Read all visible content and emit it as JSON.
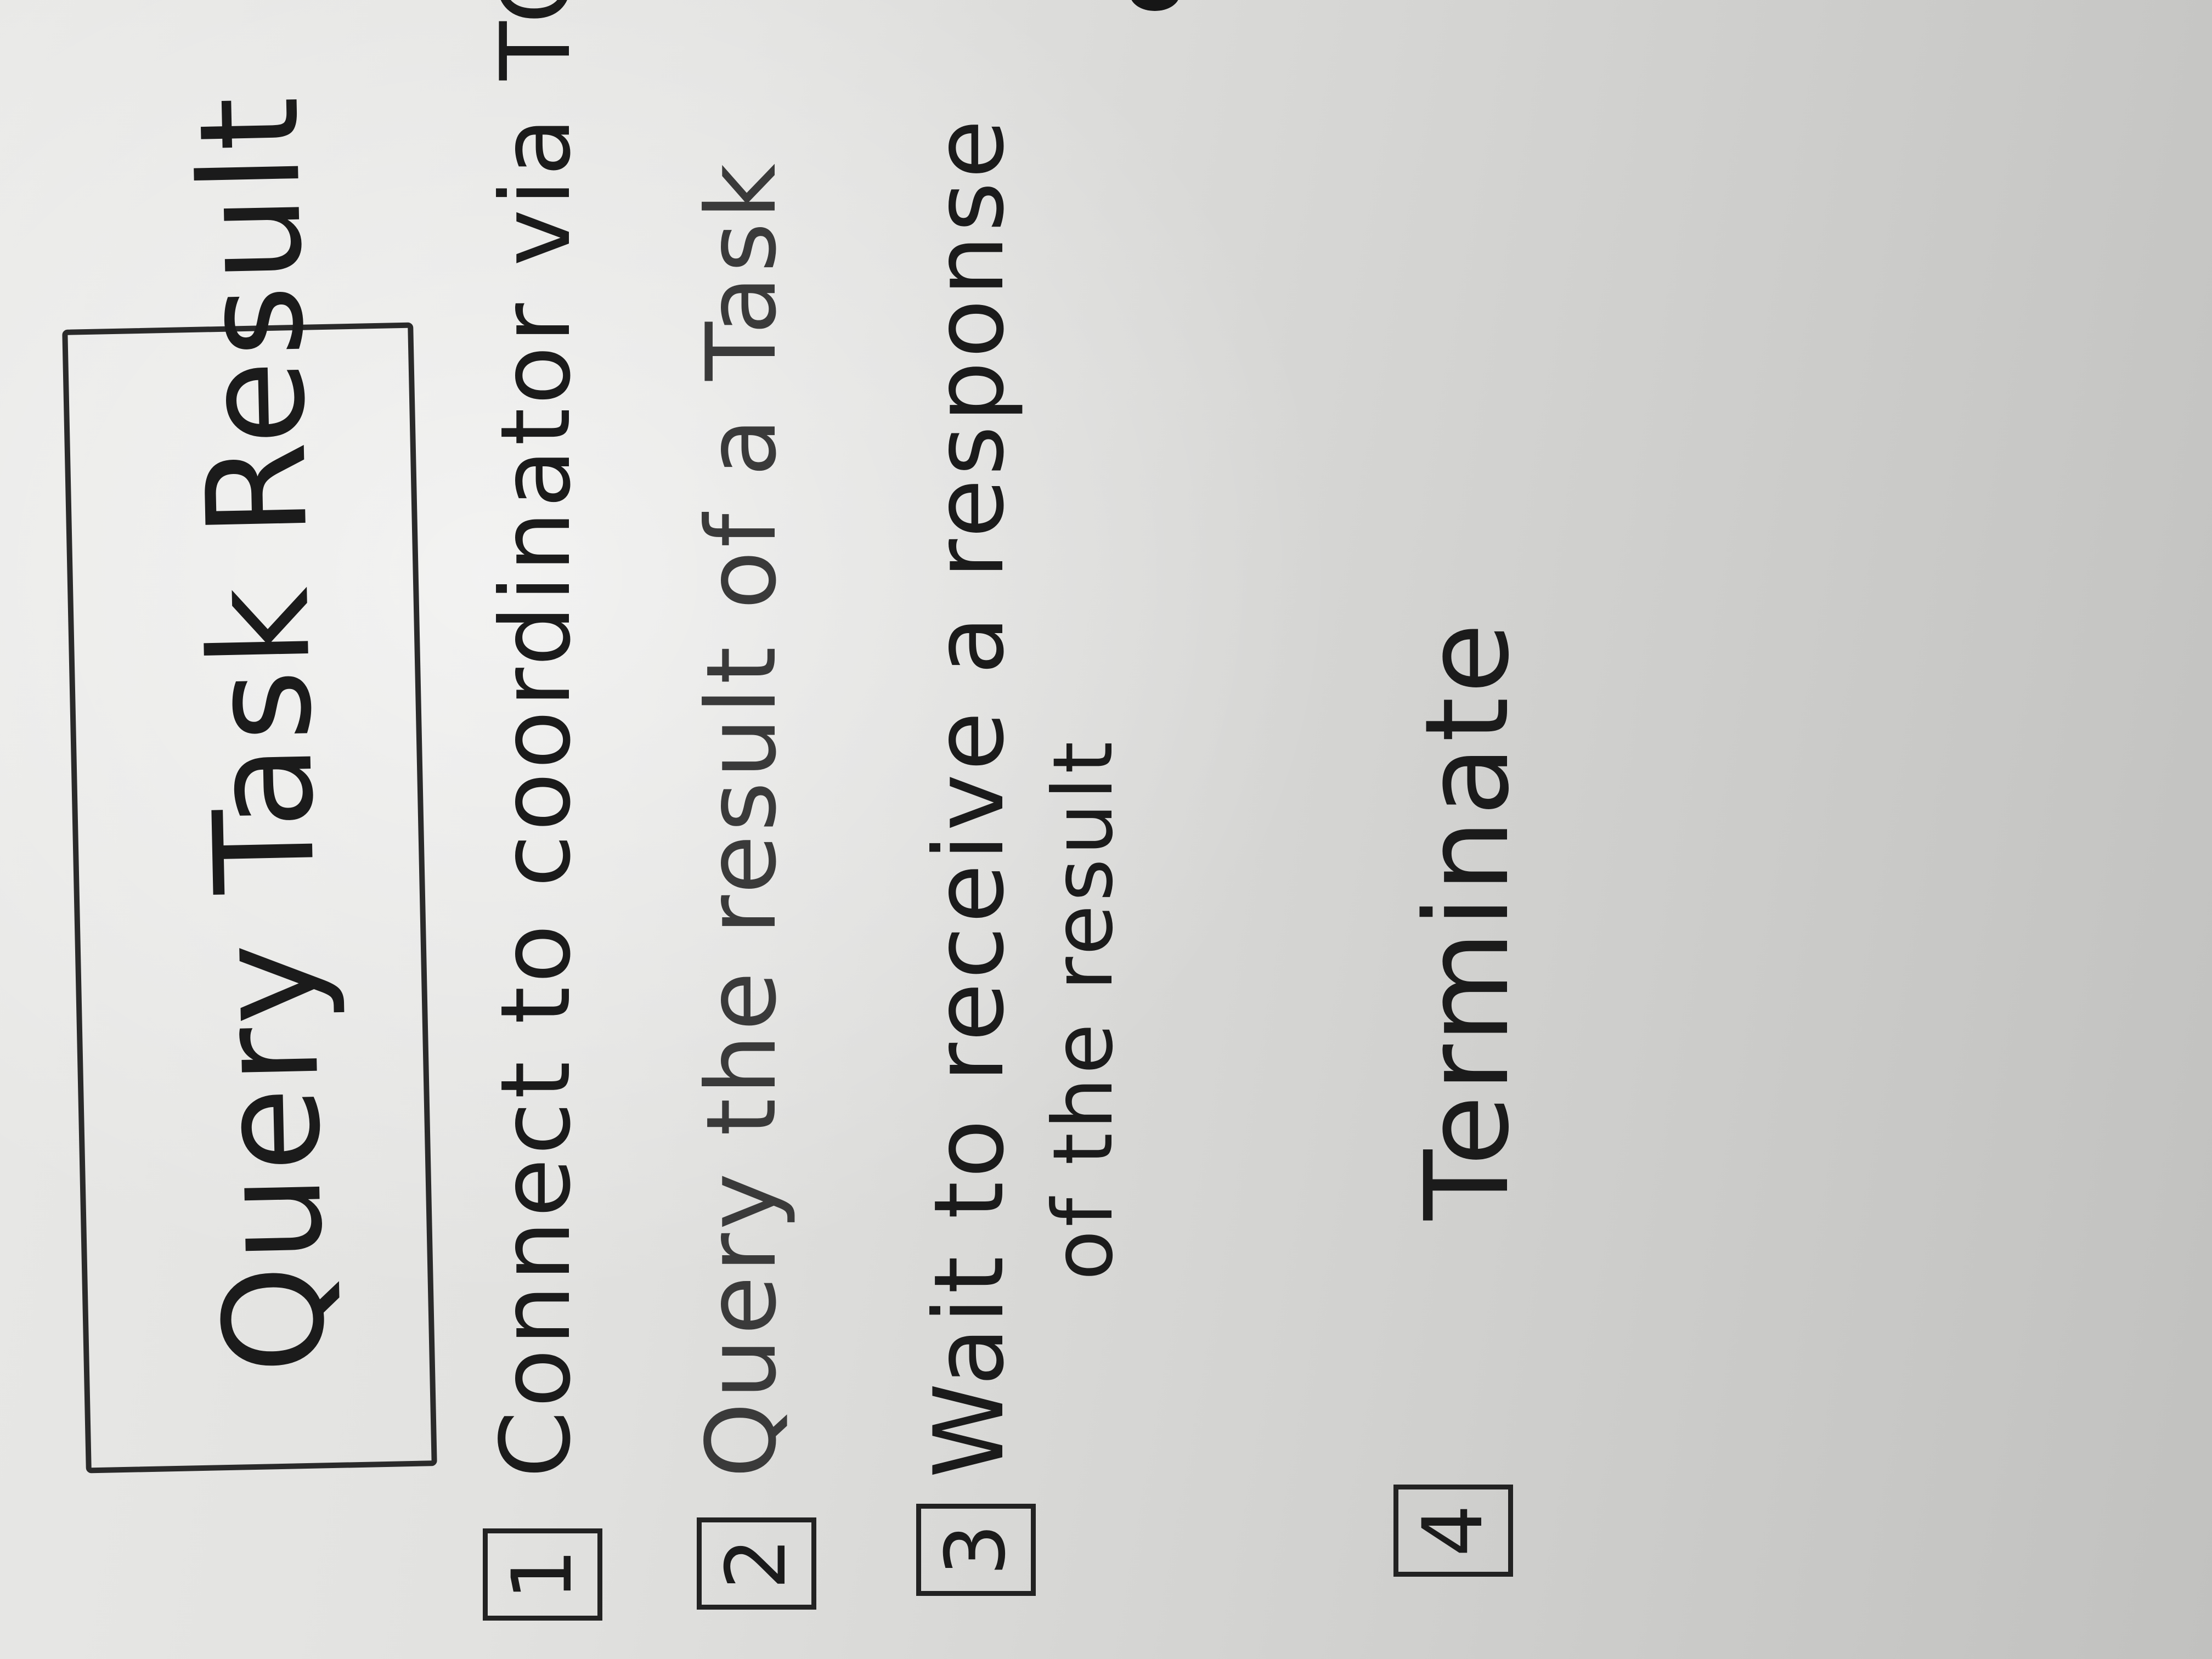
{
  "board": {
    "title": "Query Task Result",
    "steps": [
      {
        "number": "1",
        "text": "Connect to coordinator via TCP/IP"
      },
      {
        "number": "2",
        "text": "Query the result of a Task"
      },
      {
        "number": "3",
        "text": "Wait to receive a response",
        "continuation": "of the result"
      },
      {
        "number": "4",
        "text": "Terminate"
      }
    ]
  },
  "colors": {
    "whiteboard": "#e4e4e2",
    "ink": "#1b1b1b",
    "faded_ink": "#3a3a3a"
  }
}
